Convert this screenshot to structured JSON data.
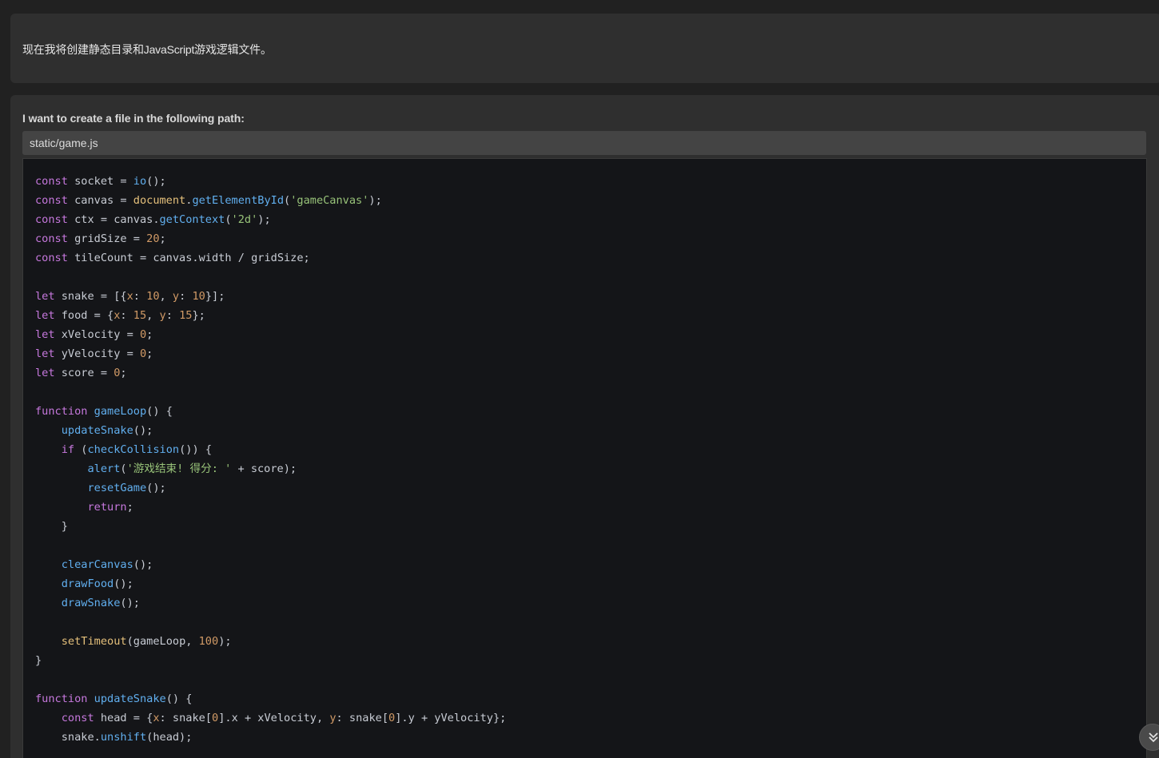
{
  "message": {
    "text": "现在我将创建静态目录和JavaScript游戏逻辑文件。"
  },
  "tool_request": {
    "label": "I want to create a file in the following path:",
    "path": "static/game.js",
    "code_lines": [
      "const socket = io();",
      "const canvas = document.getElementById('gameCanvas');",
      "const ctx = canvas.getContext('2d');",
      "const gridSize = 20;",
      "const tileCount = canvas.width / gridSize;",
      "",
      "let snake = [{x: 10, y: 10}];",
      "let food = {x: 15, y: 15};",
      "let xVelocity = 0;",
      "let yVelocity = 0;",
      "let score = 0;",
      "",
      "function gameLoop() {",
      "    updateSnake();",
      "    if (checkCollision()) {",
      "        alert('游戏结束! 得分: ' + score);",
      "        resetGame();",
      "        return;",
      "    }",
      "",
      "    clearCanvas();",
      "    drawFood();",
      "    drawSnake();",
      "",
      "    setTimeout(gameLoop, 100);",
      "}",
      "",
      "function updateSnake() {",
      "    const head = {x: snake[0].x + xVelocity, y: snake[0].y + yVelocity};",
      "    snake.unshift(head);"
    ]
  },
  "controls": {
    "scroll_down_icon": "double-chevron-down-icon"
  },
  "colors": {
    "background": "#212121",
    "card": "#2f2f2f",
    "code_background": "#141518",
    "keyword": "#c678dd",
    "function": "#61afef",
    "string": "#98c379",
    "number": "#d19a66"
  }
}
